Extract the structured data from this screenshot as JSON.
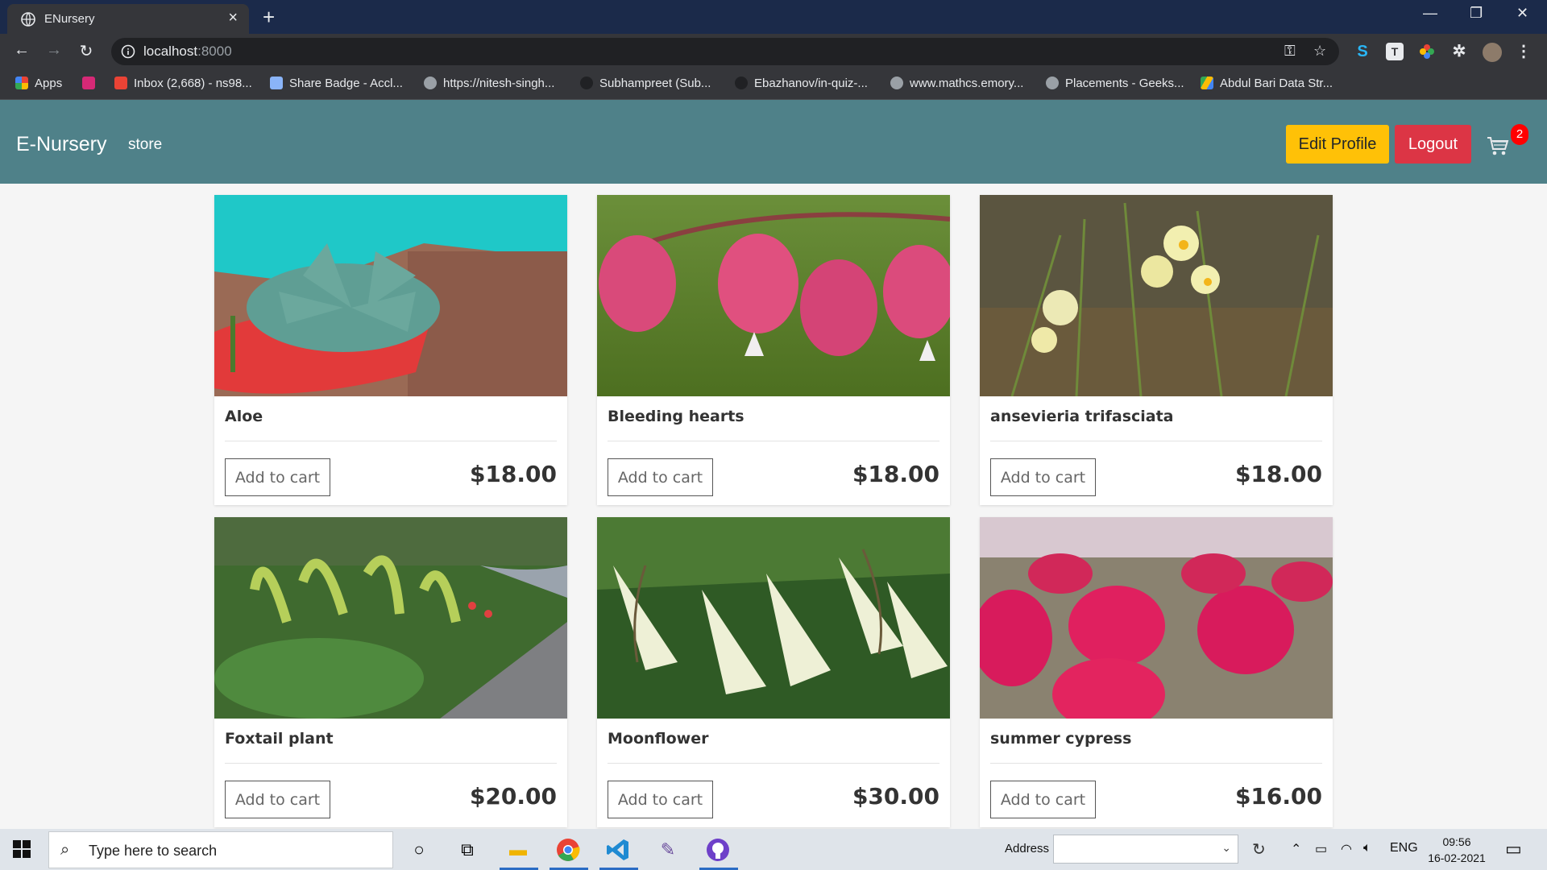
{
  "browser": {
    "tab_title": "ENursery",
    "url_host": "localhost",
    "url_port": ":8000",
    "bookmarks": [
      {
        "label": "Apps",
        "icon": "apps-grid-icon",
        "color": "#ea4335"
      },
      {
        "label": "",
        "icon": "instagram-icon",
        "color": "#d62976"
      },
      {
        "label": "Inbox (2,668) - ns98...",
        "icon": "gmail-icon",
        "color": "#ea4335"
      },
      {
        "label": "Share Badge - Accl...",
        "icon": "badge-icon",
        "color": "#8ab4f8"
      },
      {
        "label": "https://nitesh-singh...",
        "icon": "globe-icon",
        "color": "#9aa0a6"
      },
      {
        "label": "Subhampreet (Sub...",
        "icon": "github-icon",
        "color": "#202124"
      },
      {
        "label": "Ebazhanov/in-quiz-...",
        "icon": "github-icon",
        "color": "#202124"
      },
      {
        "label": "www.mathcs.emory...",
        "icon": "globe-icon",
        "color": "#9aa0a6"
      },
      {
        "label": "Placements - Geeks...",
        "icon": "globe-icon",
        "color": "#9aa0a6"
      },
      {
        "label": "Abdul Bari Data Str...",
        "icon": "google-drive-icon",
        "color": "#fbbc04"
      }
    ]
  },
  "navbar": {
    "brand": "E-Nursery",
    "store_link": "store",
    "edit_profile": "Edit Profile",
    "logout": "Logout",
    "cart_count": "2"
  },
  "products": [
    {
      "name": "Aloe",
      "price": "$18.00",
      "add_label": "Add to cart",
      "image": "succulent-in-red-pot"
    },
    {
      "name": "Bleeding hearts",
      "price": "$18.00",
      "add_label": "Add to cart",
      "image": "pink-bleeding-heart-flowers"
    },
    {
      "name": "ansevieria trifasciata",
      "price": "$18.00",
      "add_label": "Add to cart",
      "image": "pale-yellow-wildflowers"
    },
    {
      "name": "Foxtail plant",
      "price": "$20.00",
      "add_label": "Add to cart",
      "image": "foxtail-agave-garden-path"
    },
    {
      "name": "Moonflower",
      "price": "$30.00",
      "add_label": "Add to cart",
      "image": "white-trumpet-flowers"
    },
    {
      "name": "summer cypress",
      "price": "$16.00",
      "add_label": "Add to cart",
      "image": "red-kochia-bushes"
    }
  ],
  "taskbar": {
    "search_placeholder": "Type here to search",
    "address_label": "Address",
    "language": "ENG",
    "time": "09:56",
    "date": "16-02-2021"
  },
  "colors": {
    "navbar_bg": "#4f8189",
    "edit_profile_bg": "#ffc107",
    "logout_bg": "#dc3545",
    "cart_badge_bg": "#ff0000"
  }
}
